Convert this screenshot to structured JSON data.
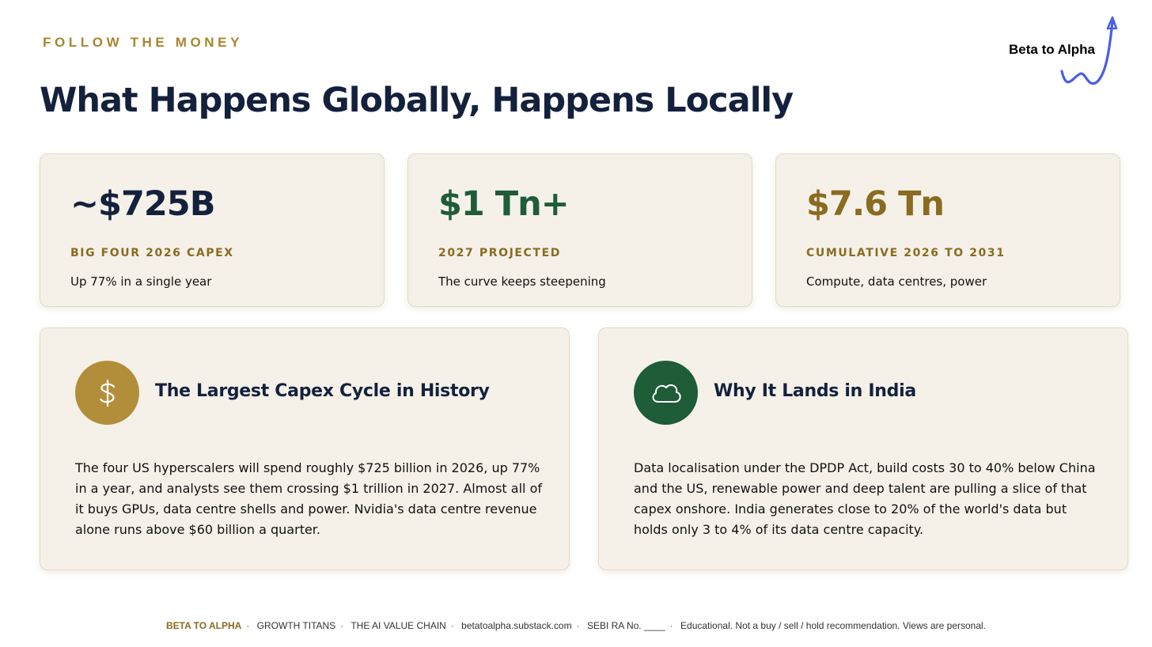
{
  "header": {
    "eyebrow": "FOLLOW THE MONEY",
    "title": "What Happens Globally, Happens Locally"
  },
  "logo": {
    "text": "Beta to Alpha",
    "accent_color": "#4a5de6"
  },
  "stats": [
    {
      "value": "~$725B",
      "label": "BIG FOUR 2026 CAPEX",
      "description": "Up 77% in a single year",
      "color": "#14213d"
    },
    {
      "value": "$1 Tn+",
      "label": "2027 PROJECTED",
      "description": "The curve keeps steepening",
      "color": "#1f5c38"
    },
    {
      "value": "$7.6 Tn",
      "label": "CUMULATIVE 2026 TO 2031",
      "description": "Compute, data centres, power",
      "color": "#8a6b1f"
    }
  ],
  "details": [
    {
      "icon": "dollar-icon",
      "icon_bg": "#b38e3a",
      "heading": "The Largest Capex Cycle in History",
      "body": "The four US hyperscalers will spend roughly $725 billion in 2026, up 77% in a year, and analysts see them crossing $1 trillion in 2027. Almost all of it buys GPUs, data centre shells and power. Nvidia's data centre revenue alone runs above $60 billion a quarter."
    },
    {
      "icon": "cloud-icon",
      "icon_bg": "#1f5c38",
      "heading": "Why It Lands in India",
      "body": "Data localisation under the DPDP Act, build costs 30 to 40% below China and the US, renewable power and deep talent are pulling a slice of that capex onshore. India generates close to 20% of the world's data but holds only 3 to 4% of its data centre capacity."
    }
  ],
  "footer": {
    "brand": "BETA TO ALPHA",
    "items": [
      "GROWTH TITANS",
      "THE AI VALUE CHAIN",
      "betatoalpha.substack.com",
      "SEBI RA No. ____",
      "Educational. Not a buy / sell / hold recommendation. Views are personal."
    ]
  }
}
